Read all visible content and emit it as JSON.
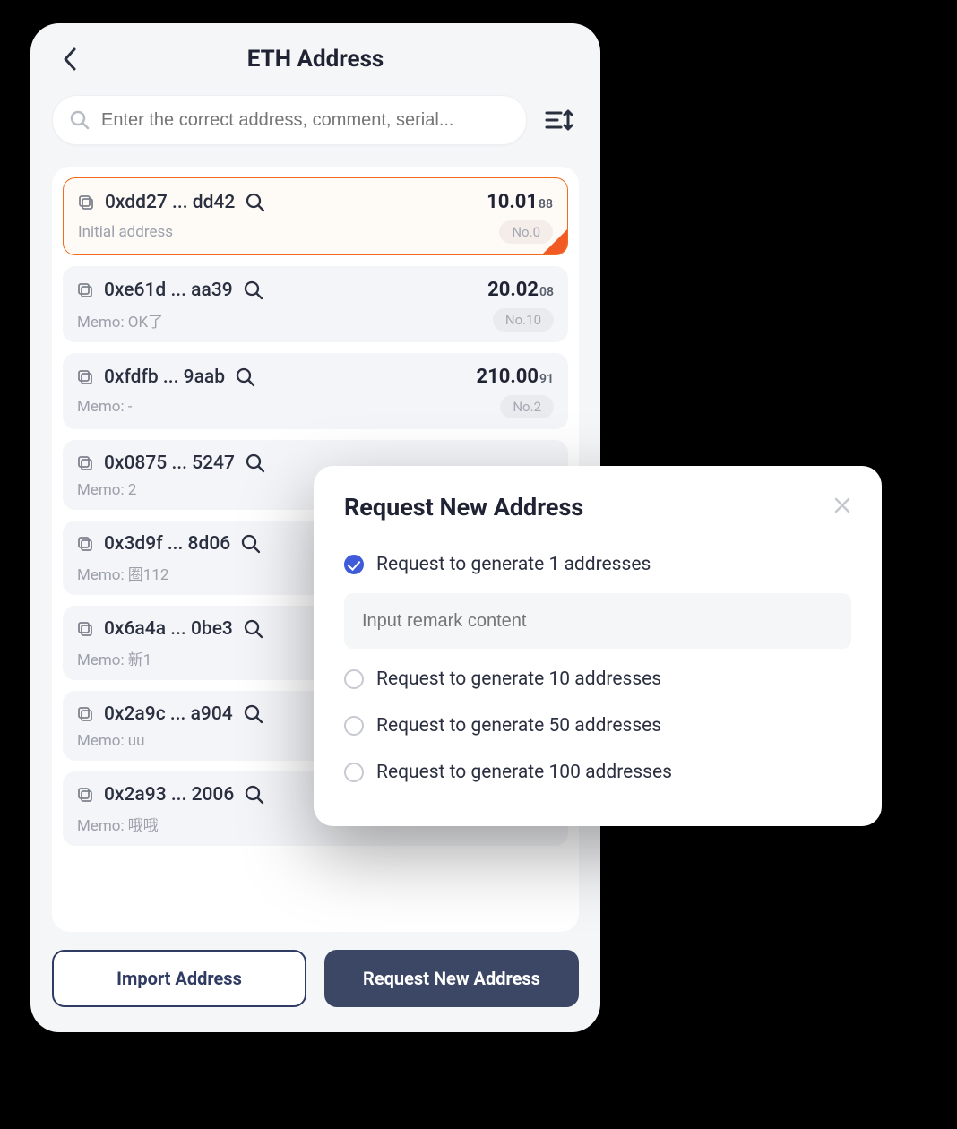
{
  "header": {
    "title": "ETH Address"
  },
  "search": {
    "placeholder": "Enter the correct address, comment, serial..."
  },
  "addresses": [
    {
      "addr": "0xdd27 ... dd42",
      "balance_main": "10.01",
      "balance_dec": "88",
      "memo": "Initial address",
      "badge": "No.0",
      "selected": true
    },
    {
      "addr": "0xe61d ... aa39",
      "balance_main": "20.02",
      "balance_dec": "08",
      "memo": "Memo: OK了",
      "badge": "No.10",
      "selected": false
    },
    {
      "addr": "0xfdfb ... 9aab",
      "balance_main": "210.00",
      "balance_dec": "91",
      "memo": "Memo: -",
      "badge": "No.2",
      "selected": false
    },
    {
      "addr": "0x0875 ... 5247",
      "balance_main": "",
      "balance_dec": "",
      "memo": "Memo: 2",
      "badge": "",
      "selected": false
    },
    {
      "addr": "0x3d9f ... 8d06",
      "balance_main": "",
      "balance_dec": "",
      "memo": "Memo: 圈112",
      "badge": "",
      "selected": false
    },
    {
      "addr": "0x6a4a ... 0be3",
      "balance_main": "",
      "balance_dec": "",
      "memo": "Memo: 新1",
      "badge": "",
      "selected": false
    },
    {
      "addr": "0x2a9c ... a904",
      "balance_main": "",
      "balance_dec": "",
      "memo": "Memo: uu",
      "badge": "",
      "selected": false
    },
    {
      "addr": "0x2a93 ... 2006",
      "balance_main": "",
      "balance_dec": "",
      "memo": "Memo: 哦哦",
      "badge": "",
      "selected": false
    }
  ],
  "footer": {
    "import_label": "Import Address",
    "request_label": "Request New Address"
  },
  "modal": {
    "title": "Request New Address",
    "remark_placeholder": "Input remark content",
    "options": [
      {
        "label": "Request to generate 1 addresses",
        "checked": true
      },
      {
        "label": "Request to generate 10 addresses",
        "checked": false
      },
      {
        "label": "Request to generate 50 addresses",
        "checked": false
      },
      {
        "label": "Request to generate 100 addresses",
        "checked": false
      }
    ]
  }
}
